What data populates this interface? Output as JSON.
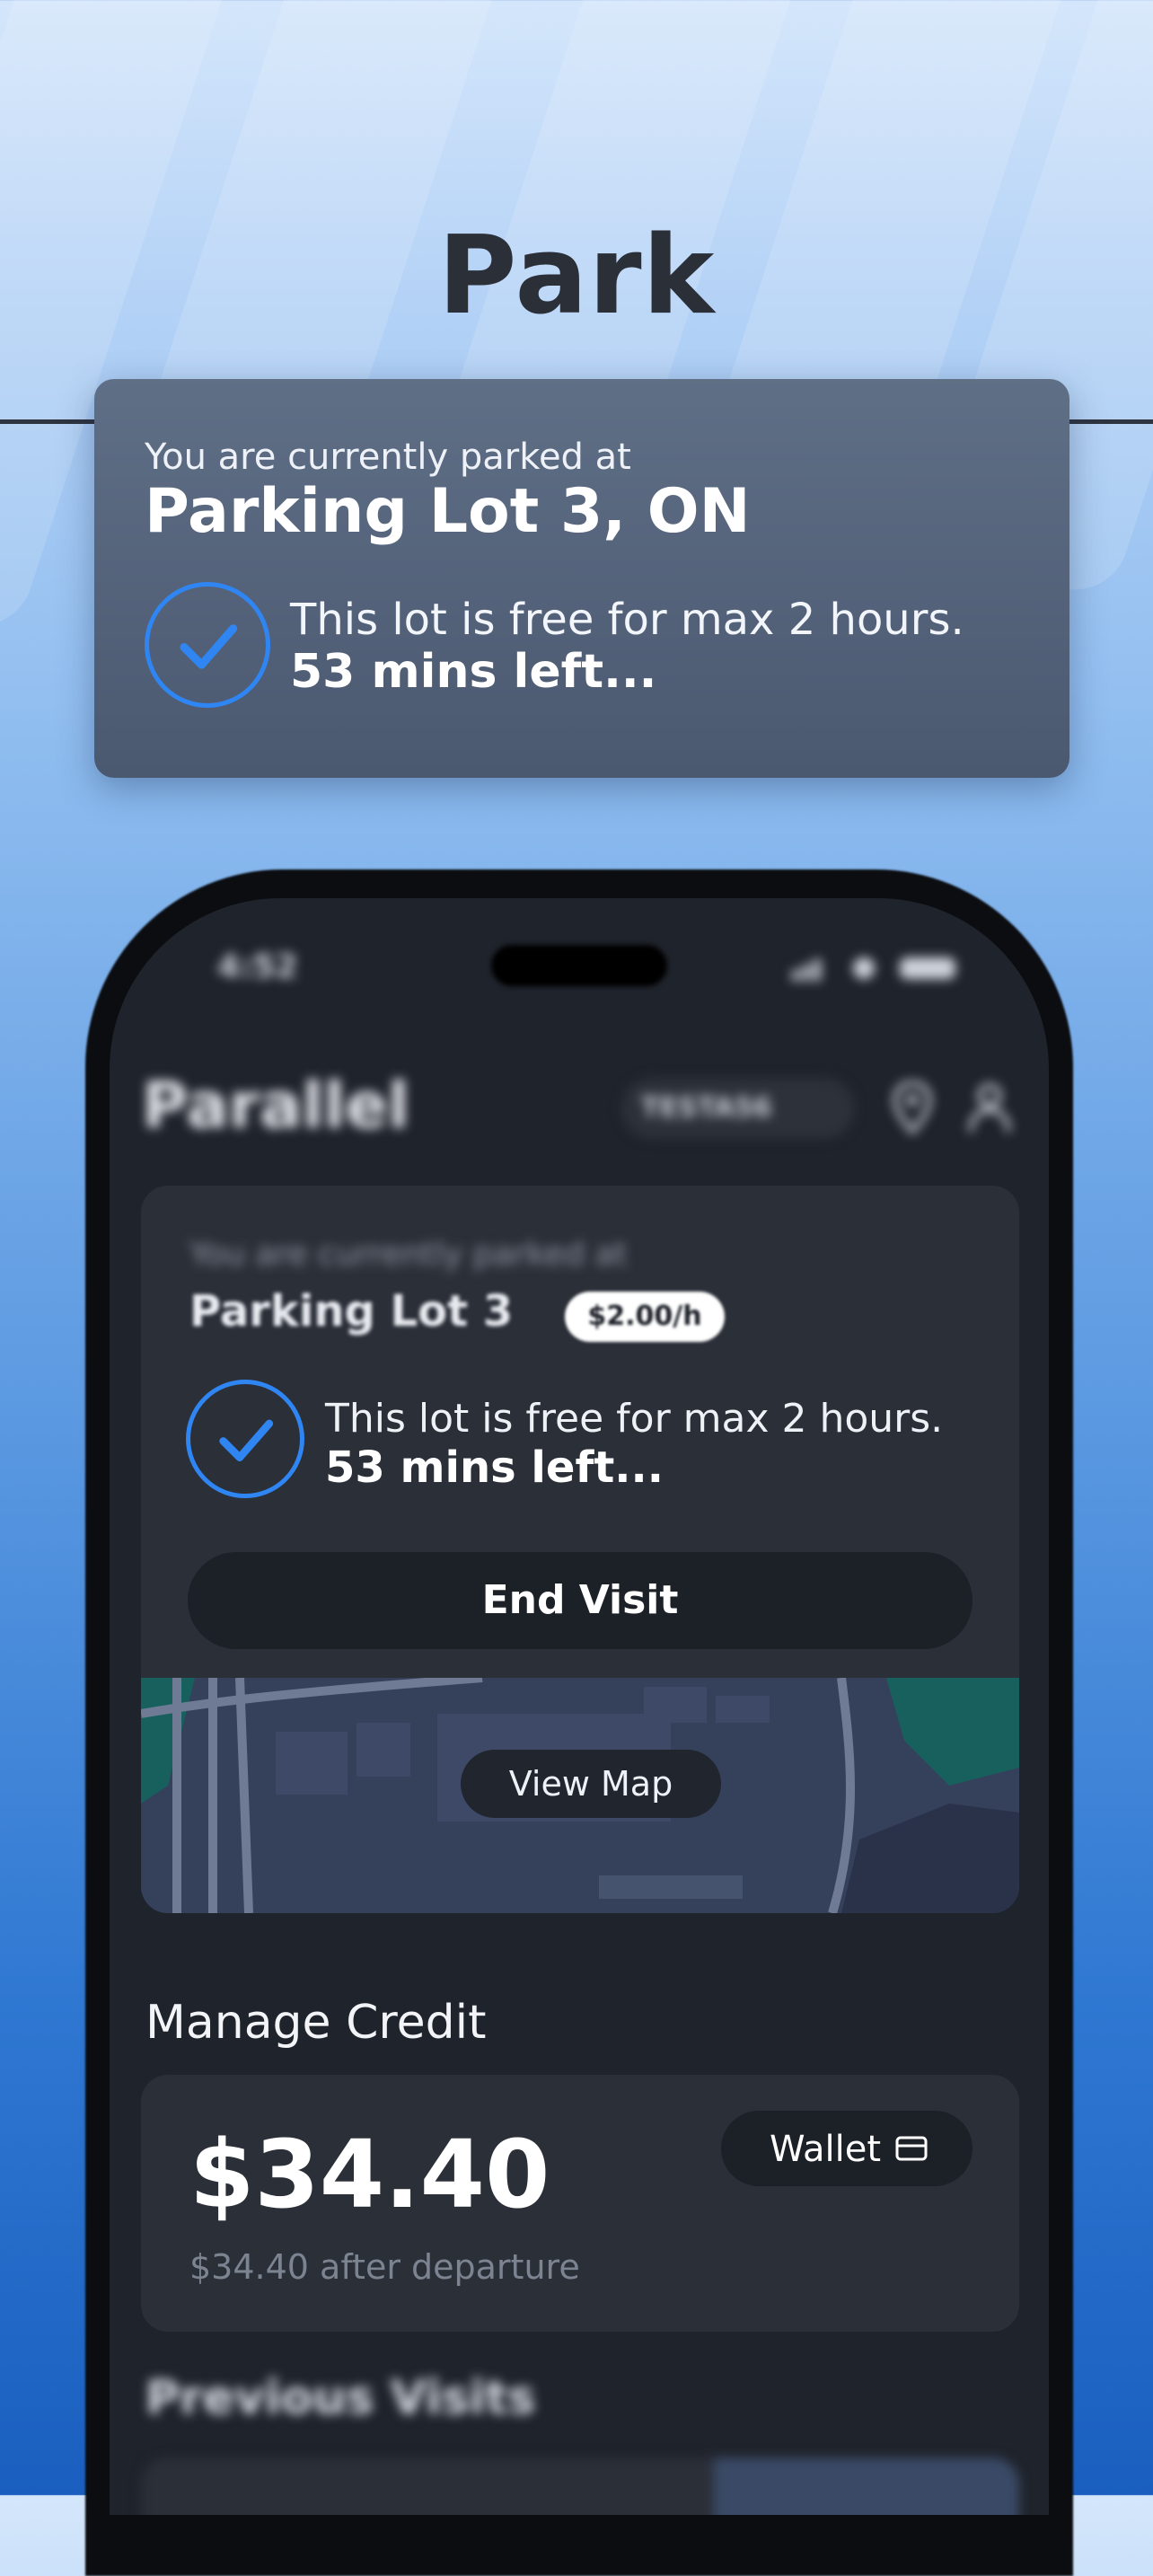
{
  "header": {
    "title": "Park"
  },
  "summary_card": {
    "subtitle": "You are currently parked at",
    "lot": "Parking Lot 3, ON",
    "free_text": "This lot is free for max 2 hours.",
    "time_left": "53 mins left..."
  },
  "phone": {
    "app_name": "Parallel",
    "plate": "TESTA56",
    "status_time": "4:52",
    "parking_card": {
      "subtitle": "You are currently parked at",
      "lot": "Parking Lot 3",
      "price": "$2.00/h",
      "free_text": "This lot is free for max 2 hours.",
      "time_left": "53 mins left...",
      "end_button": "End Visit",
      "view_map_button": "View Map"
    },
    "manage_credit": {
      "title": "Manage Credit",
      "amount": "$34.40",
      "after_departure": "$34.40 after departure",
      "wallet_button": "Wallet"
    },
    "previous_visits": {
      "title": "Previous Visits"
    }
  },
  "icons": {
    "check": "check-circle-icon",
    "pin": "location-pin-icon",
    "profile": "profile-icon",
    "wallet": "card-icon"
  },
  "colors": {
    "accent": "#2f86f2",
    "top_card": "#56657c",
    "screen_bg": "#1f232b",
    "card_bg": "#2b2f38"
  }
}
